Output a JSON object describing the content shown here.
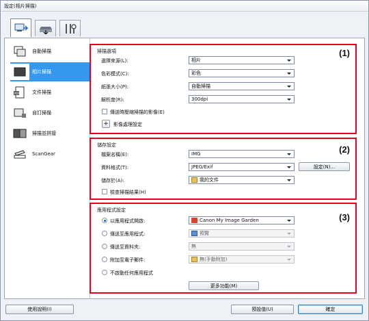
{
  "title": "設定(相片掃描)",
  "tabs": [
    {
      "icon": "scan-from-computer-icon"
    },
    {
      "icon": "scan-from-operation-panel-icon"
    },
    {
      "icon": "general-settings-icon"
    }
  ],
  "sidebar": {
    "items": [
      {
        "label": "自動掃描",
        "icon": "auto-scan-icon",
        "selected": false
      },
      {
        "label": "相片掃描",
        "icon": "photo-scan-icon",
        "selected": true
      },
      {
        "label": "文件掃描",
        "icon": "document-scan-icon",
        "selected": false
      },
      {
        "label": "自訂掃描",
        "icon": "custom-scan-icon",
        "selected": false
      },
      {
        "label": "掃描並拼接",
        "icon": "scan-and-stitch-icon",
        "selected": false
      },
      {
        "label": "ScanGear",
        "icon": "scangear-icon",
        "selected": false
      }
    ]
  },
  "scan_options": {
    "group_title": "掃描選項",
    "number": "(1)",
    "source": {
      "label": "選擇來源(L):",
      "value": "相片"
    },
    "color_mode": {
      "label": "色彩模式(C):",
      "value": "彩色"
    },
    "paper_size": {
      "label": "紙張大小(P):",
      "value": "自動掃描"
    },
    "resolution": {
      "label": "解析度(R):",
      "value": "300dpi"
    },
    "compress_label": "傳送時壓縮掃描的影像(E)",
    "image_processing_label": "影像處理設定"
  },
  "save_settings": {
    "group_title": "儲存設定",
    "number": "(2)",
    "file_name": {
      "label": "檔案名稱(E):",
      "value": "IMG"
    },
    "data_format": {
      "label": "資料格式(T):",
      "value": "JPEG/Exif"
    },
    "settings_button": "設定(N)...",
    "save_in": {
      "label": "儲存於(A):",
      "value": "我的文件"
    },
    "check_result_label": "檢查掃描結果(H)"
  },
  "app_settings": {
    "group_title": "應用程式設定",
    "number": "(3)",
    "options": [
      {
        "label": "以應用程式開啟:",
        "value": "Canon My Image Garden",
        "selected": true,
        "enabled": true
      },
      {
        "label": "傳送至應用程式:",
        "value": "預覽",
        "selected": false,
        "enabled": false
      },
      {
        "label": "傳送至資料夾:",
        "value": "無",
        "selected": false,
        "enabled": false
      },
      {
        "label": "附加至電子郵件:",
        "value": "無(手動附加)",
        "selected": false,
        "enabled": false
      },
      {
        "label": "不啟動任何應用程式",
        "value": "",
        "selected": false,
        "enabled": false
      }
    ],
    "more_button": "更多功能(M)"
  },
  "footer": {
    "help_button": "使用說明(I)",
    "defaults_button": "預設值(U)",
    "ok_button": "確定"
  }
}
